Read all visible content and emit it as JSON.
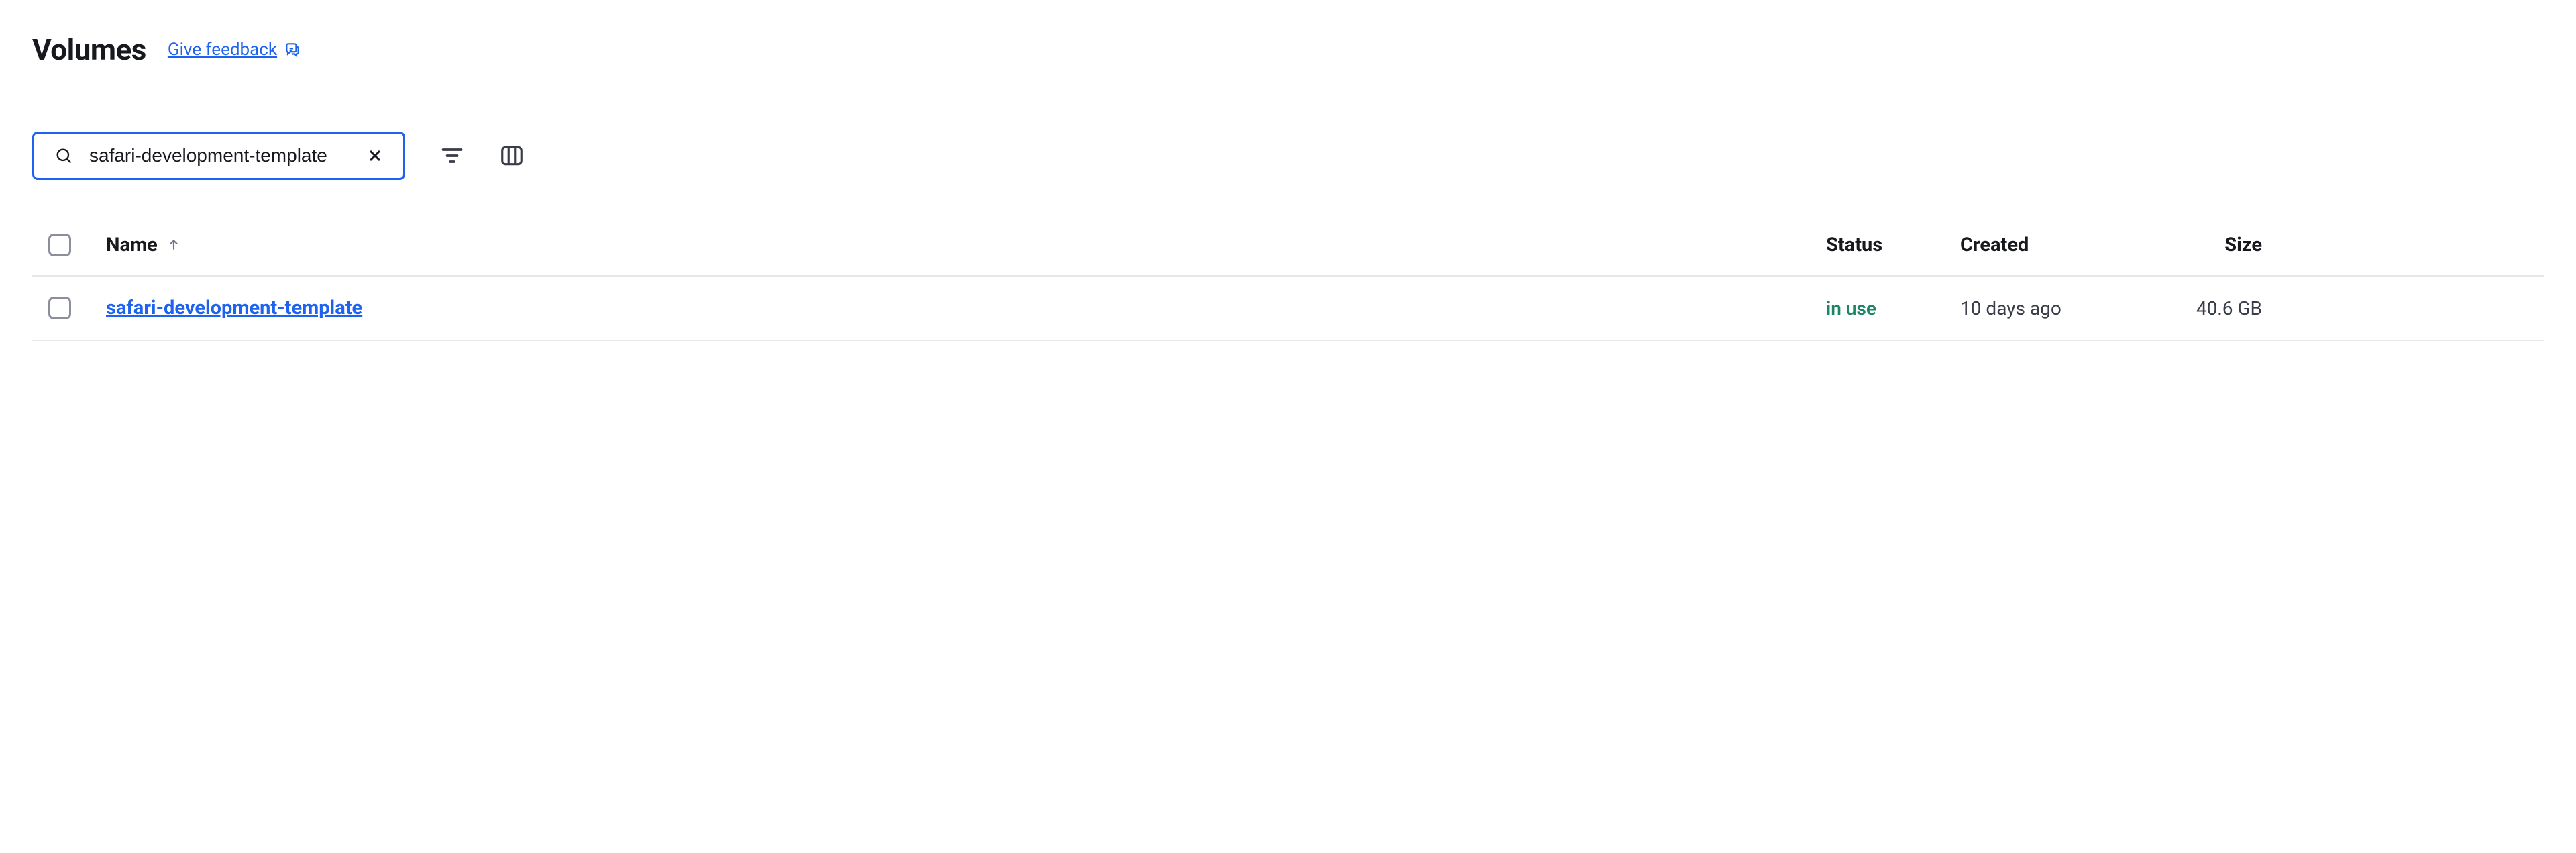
{
  "header": {
    "title": "Volumes",
    "feedback_label": "Give feedback"
  },
  "search": {
    "value": "safari-development-template"
  },
  "columns": {
    "name": "Name",
    "status": "Status",
    "created": "Created",
    "size": "Size"
  },
  "rows": [
    {
      "name": "safari-development-template",
      "status": "in use",
      "created": "10 days ago",
      "size": "40.6 GB"
    }
  ]
}
